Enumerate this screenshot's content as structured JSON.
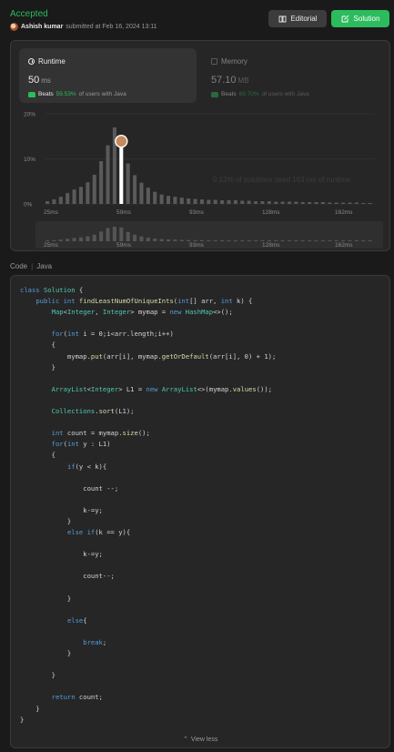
{
  "header": {
    "status": "Accepted",
    "author_name": "Ashish kumar",
    "submitted_text": "submitted at Feb 16, 2024 13:11",
    "editorial_label": "Editorial",
    "solution_label": "Solution"
  },
  "runtime": {
    "title": "Runtime",
    "value": "50",
    "unit": "ms",
    "beats_label": "Beats",
    "beats_pct": "59.53%",
    "beats_suffix": "of users with Java"
  },
  "memory": {
    "title": "Memory",
    "value": "57.10",
    "unit": "MB",
    "beats_label": "Beats",
    "beats_pct": "69.70%",
    "beats_suffix": "of users with Java"
  },
  "chart_data": {
    "type": "bar",
    "yticks": [
      "20%",
      "10%",
      "0%"
    ],
    "ylim": [
      0,
      20
    ],
    "xticks": [
      "25ms",
      "59ms",
      "93ms",
      "128ms",
      "162ms"
    ],
    "values": [
      0.6,
      1.0,
      1.6,
      2.4,
      3.2,
      3.8,
      4.8,
      6.5,
      9.5,
      13.0,
      17.0,
      13.5,
      9.0,
      6.4,
      4.7,
      3.6,
      2.7,
      2.1,
      1.8,
      1.6,
      1.4,
      1.2,
      1.1,
      1.0,
      0.9,
      0.9,
      0.8,
      0.8,
      0.8,
      0.7,
      0.7,
      0.6,
      0.6,
      0.6,
      0.5,
      0.5,
      0.5,
      0.5,
      0.4,
      0.4,
      0.4,
      0.4,
      0.3,
      0.3,
      0.3,
      0.3,
      0.3,
      0.2,
      0.2
    ],
    "highlight_index": 11,
    "tooltip": "0.12% of solutions used 163 ms of runtime",
    "grid": true,
    "colors": {
      "bar": "#5a5a5a",
      "highlight": "#ffffff"
    }
  },
  "code_section": {
    "label": "Code",
    "language": "Java",
    "view_less": "View less",
    "lines": [
      "class Solution {",
      "    public int findLeastNumOfUniqueInts(int[] arr, int k) {",
      "        Map<Integer, Integer> mymap = new HashMap<>();",
      "",
      "        for(int i = 0;i<arr.length;i++)",
      "        {",
      "            mymap.put(arr[i], mymap.getOrDefault(arr[i], 0) + 1);",
      "        }",
      "",
      "        ArrayList<Integer> L1 = new ArrayList<>(mymap.values());",
      "",
      "        Collections.sort(L1);",
      "",
      "        int count = mymap.size();",
      "        for(int y : L1)",
      "        {",
      "            if(y < k){",
      "",
      "                count --;",
      "",
      "                k-=y;",
      "            }",
      "            else if(k == y){",
      "",
      "                k-=y;",
      "",
      "                count--;",
      "",
      "            }",
      "",
      "            else{",
      "",
      "                break;",
      "            }",
      "",
      "        }",
      "",
      "        return count;",
      "    }",
      "}"
    ]
  }
}
